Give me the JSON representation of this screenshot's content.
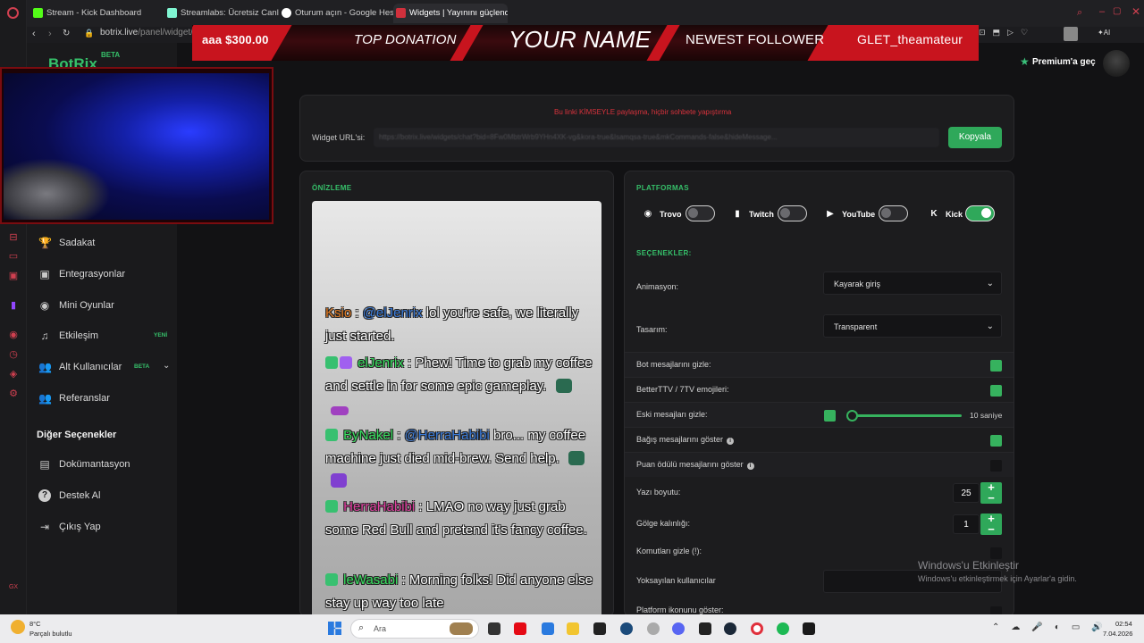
{
  "browser": {
    "tabs": [
      {
        "title": "Stream - Kick Dashboard",
        "color": "#53fc18"
      },
      {
        "title": "Streamlabs: Ücretsiz Canl",
        "color": "#80f5d2"
      },
      {
        "title": "Oturum açın - Google Hes",
        "color": "#ffffff"
      },
      {
        "title": "Widgets | Yayınını güçlend",
        "color": "#d0303c"
      }
    ],
    "url_host": "botrix.live",
    "url_path": "/panel/widget/chat"
  },
  "overlay": {
    "donation_amount": "aaa $300.00",
    "top_donation": "TOP DONATION",
    "your_name": "YOUR NAME",
    "newest_follower": "NEWEST FOLLOWER",
    "follower_name": "GLET_theamateur"
  },
  "sidebar": {
    "brand": "BotRix",
    "brand_badge": "BETA",
    "items": [
      {
        "label": "Sadakat",
        "icon": "trophy-icon",
        "glyph": "🏆"
      },
      {
        "label": "Entegrasyonlar",
        "icon": "integrations-icon",
        "glyph": "▣"
      },
      {
        "label": "Mini Oyunlar",
        "icon": "gamepad-icon",
        "glyph": "◉"
      },
      {
        "label": "Etkileşim",
        "icon": "music-icon",
        "glyph": "♫",
        "badge": "YENİ"
      },
      {
        "label": "Alt Kullanıcılar",
        "icon": "users-icon",
        "glyph": "👥",
        "badge": "BETA"
      },
      {
        "label": "Referanslar",
        "icon": "referrals-icon",
        "glyph": "👥"
      }
    ],
    "other_section": "Diğer Seçenekler",
    "other_items": [
      {
        "label": "Dokümantasyon",
        "icon": "docs-icon",
        "glyph": "▤"
      },
      {
        "label": "Destek Al",
        "icon": "help-icon",
        "glyph": "?"
      },
      {
        "label": "Çıkış Yap",
        "icon": "logout-icon",
        "glyph": "⇥"
      }
    ]
  },
  "header": {
    "premium": "Premium'a geç"
  },
  "widget_url": {
    "warning": "Bu linki KİMSEYLE paylaşma, hiçbir sohbete yapıştırma",
    "label": "Widget URL'si:",
    "value": "https://botrix.live/widgets/chat?bid=8Fw0MbtrWrb9YHn4XK-vg&kora-true&lsamqsa-true&mkCommands-false&hideMessage...",
    "copy": "Kopyala"
  },
  "preview": {
    "title": "ÖNİZLEME",
    "messages": [
      {
        "user": "Ksio",
        "user_color": "#e07820",
        "sep": " : ",
        "mention": "@elJenrix",
        "text": " lol you're safe, we literally just started.",
        "badges": [],
        "emotes": []
      },
      {
        "user": "elJenrix",
        "user_color": "#38e060",
        "sep": " : ",
        "mention": "",
        "text": "Phew! Time to grab my coffee and settle in for some epic gameplay.",
        "badges": [
          "#38c070",
          "#a060f0"
        ],
        "emotes": [
          "#2a6a50",
          "#a040c0"
        ]
      },
      {
        "user": "ByNakel",
        "user_color": "#38e060",
        "sep": " : ",
        "mention": "@HerraHabibi",
        "text": " bro... my coffee machine just died mid-brew. Send help.",
        "badges": [
          "#38c070"
        ],
        "emotes": [
          "#2a6a50",
          "#8040d0"
        ]
      },
      {
        "user": "HerraHabibi",
        "user_color": "#e040a0",
        "sep": " : ",
        "mention": "",
        "text": "LMAO no way just grab some Red Bull and pretend it's fancy coffee.",
        "badges": [
          "#38c070"
        ],
        "emotes": [
          "#7030a0"
        ]
      },
      {
        "user": "leWasabi",
        "user_color": "#38e060",
        "sep": " : ",
        "mention": "",
        "text": "Morning folks! Did anyone else stay up way too late",
        "badges": [
          "#38c070"
        ],
        "emotes": []
      }
    ]
  },
  "platforms": {
    "title": "PLATFORMAS",
    "items": [
      {
        "label": "Trovo",
        "on": false
      },
      {
        "label": "Twitch",
        "on": false
      },
      {
        "label": "YouTube",
        "on": false
      },
      {
        "label": "Kick",
        "on": true
      }
    ]
  },
  "options": {
    "title": "SEÇENEKLER:",
    "animation_label": "Animasyon:",
    "animation_value": "Kayarak giriş",
    "design_label": "Tasarım:",
    "design_value": "Transparent",
    "hide_bots": "Bot mesajlarını gizle:",
    "emotes": "BetterTTV / 7TV emojileri:",
    "hide_old": "Eski mesajları gizle:",
    "hide_old_seconds": "10 saniye",
    "show_donations": "Bağış mesajlarını göster",
    "show_points": "Puan ödülü mesajlarını göster",
    "font_size_label": "Yazı boyutu:",
    "font_size": "25",
    "shadow_label": "Gölge kalınlığı:",
    "shadow": "1",
    "hide_commands": "Komutları gizle (!):",
    "ignored_users": "Yoksayılan kullanıcılar",
    "platform_icon": "Platform ikonunu göster:",
    "checks": {
      "hide_bots": true,
      "emotes": true,
      "hide_old": true,
      "show_donations": true,
      "show_points": false,
      "hide_commands": false,
      "platform_icon": false
    }
  },
  "windows": {
    "activate_title": "Windows'u Etkinleştir",
    "activate_sub": "Windows'u etkinleştirmek için Ayarlar'a gidin.",
    "weather_temp": "8°C",
    "weather_desc": "Parçalı bulutlu",
    "search": "Ara",
    "time": "02:54",
    "date": "7.04.2026"
  }
}
